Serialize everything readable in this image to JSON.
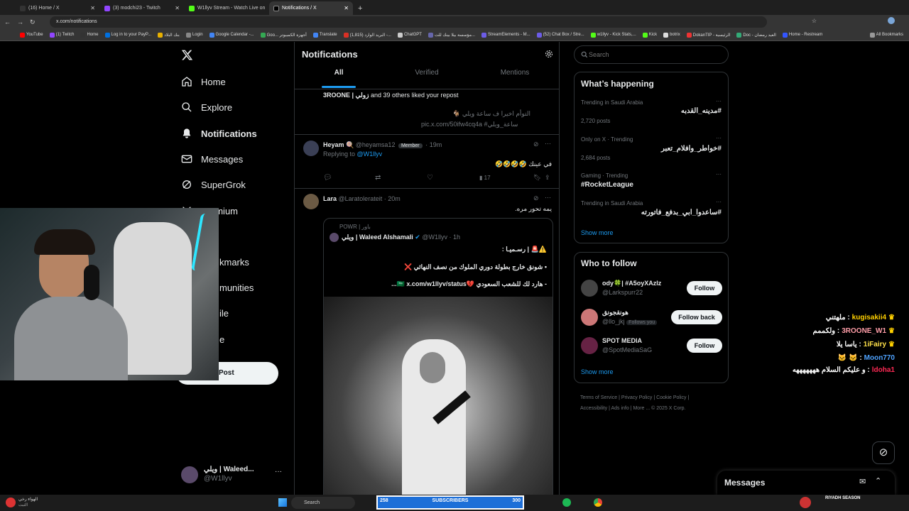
{
  "tabs": [
    {
      "title": "(16) Home / X",
      "active": false,
      "color": "#333"
    },
    {
      "title": "(3) modchi23 - Twitch",
      "active": false,
      "color": "#9146ff"
    },
    {
      "title": "W1llyv Stream - Watch Live on",
      "active": false,
      "color": "#53fc18"
    },
    {
      "title": "Notifications / X",
      "active": true,
      "color": "#000"
    }
  ],
  "address": {
    "url": "x.com/notifications"
  },
  "bookmarks": [
    "YouTube",
    "(1) Twitch",
    "Home",
    "Log in to your PayP...",
    "بنك البلاد",
    "Login",
    "Google Calendar -...",
    "Goo... أجهزة الكمبيوتر",
    "Translate",
    "البريد الوارد (1,815) -...",
    "ChatGPT",
    "مؤسسة بيلا بينك للت...",
    "StreamElements - M...",
    "(52) Chat Box / Stre...",
    "w1llyv - Kick Stats,...",
    "Kick",
    "botrix",
    "DokanTIP - الرئيسية",
    "Doc - العيد رمضان",
    "Home - Restream",
    "All Bookmarks"
  ],
  "nav": {
    "home": "Home",
    "explore": "Explore",
    "notifications": "Notifications",
    "messages": "Messages",
    "supergrok": "SuperGrok",
    "premium": "Premium",
    "bookmarks": "kmarks",
    "communities": "munities",
    "profile": "ile",
    "more": "e",
    "post": "Post"
  },
  "account": {
    "name": "ويلي | Waleed...",
    "handle": "@W1llyv"
  },
  "center": {
    "title": "Notifications",
    "tabs": [
      "All",
      "Verified",
      "Mentions"
    ],
    "like_notif": {
      "names": "3ROONE | زولي",
      "rest": "and 39 others liked your repost",
      "line1": "التوأم اخيرا ف ساعة ويلي 🐐",
      "line2": "pic.x.com/50ifw4cq4a #ساعة_ويلي"
    },
    "reply1": {
      "name": "Heyam",
      "emoji": "🍭",
      "handle": "@heyamsa12",
      "badge": "Member",
      "time": "19m",
      "replying": "Replying to",
      "replying_to": "@W1llyv",
      "text": "في عينك 🤣🤣🤣🤣",
      "views": "17"
    },
    "reply2": {
      "name": "Lara",
      "handle": "@Laratolerateit",
      "time": "20m",
      "text": "يمه تحور مره.",
      "quoted": {
        "powr": "POWR | باور",
        "name": "ويلي | Waleed Alshamali",
        "handle": "@W1llyv",
        "time": "1h",
        "line1": "⚠️🚨 | رسـميـا :",
        "line2": "• شونق خارج بطولة دوري الملوك من نصف النهائي ❌",
        "line3": "- هارد لك للشعب السعودي 💔🇸🇦 x.com/w1llyv/status..."
      }
    }
  },
  "search": {
    "placeholder": "Search"
  },
  "happening": {
    "title": "What’s happening",
    "items": [
      {
        "meta": "Trending in Saudi Arabia",
        "name": "#مدينه_القدبه",
        "posts": "2,720 posts"
      },
      {
        "meta": "Only on X · Trending",
        "name": "#خواطر_وافلام_تعبر",
        "posts": "2,684 posts"
      },
      {
        "meta": "Gaming · Trending",
        "name": "#RocketLeague",
        "posts": ""
      },
      {
        "meta": "Trending in Saudi Arabia",
        "name": "#ساعدوا_ابي_بدفع_فاتورته",
        "posts": ""
      }
    ],
    "show_more": "Show more"
  },
  "who": {
    "title": "Who to follow",
    "items": [
      {
        "name": "ody🍀| #A5oyXAzlz",
        "handle": "@Larkspurr22",
        "follows_you": "",
        "button": "Follow",
        "color": "#444"
      },
      {
        "name": "هونقجونق",
        "handle": "@llo_jkj",
        "follows_you": "Follows you",
        "button": "Follow back",
        "color": "#c77"
      },
      {
        "name": "SPOT MEDIA",
        "handle": "@SpotMediaSaG",
        "follows_you": "",
        "button": "Follow",
        "color": "#624"
      }
    ],
    "show_more": "Show more"
  },
  "footer": [
    "Terms of Service",
    "Privacy Policy",
    "Cookie Policy",
    "Accessibility",
    "Ads info",
    "More ...",
    "© 2025 X Corp."
  ],
  "messages_drawer": {
    "title": "Messages"
  },
  "chat": [
    {
      "user": "kugisakii4",
      "msg": "ملهتني :",
      "color": "#ffd000"
    },
    {
      "user": "3ROONE_W1",
      "msg": "ولكممم :",
      "color": "#ff9ea8"
    },
    {
      "user": "1iFairy",
      "msg": "ياسا يلا :",
      "color": "#ffe14a"
    },
    {
      "user": "Moon770",
      "msg": "🐱 🐱 :",
      "color": "#4fa3ff"
    },
    {
      "user": "ldoha1",
      "msg": "و عليكم السلام هههههههه :",
      "color": "#ff2a55"
    }
  ],
  "taskbar": {
    "weather": "الهواء رخي",
    "weather2": "الثبت",
    "search": "Search",
    "subs_left": "258",
    "subs_label": "SUBSCRIBERS",
    "subs_right": "300",
    "riyadh": "RIYADH SEASON"
  }
}
